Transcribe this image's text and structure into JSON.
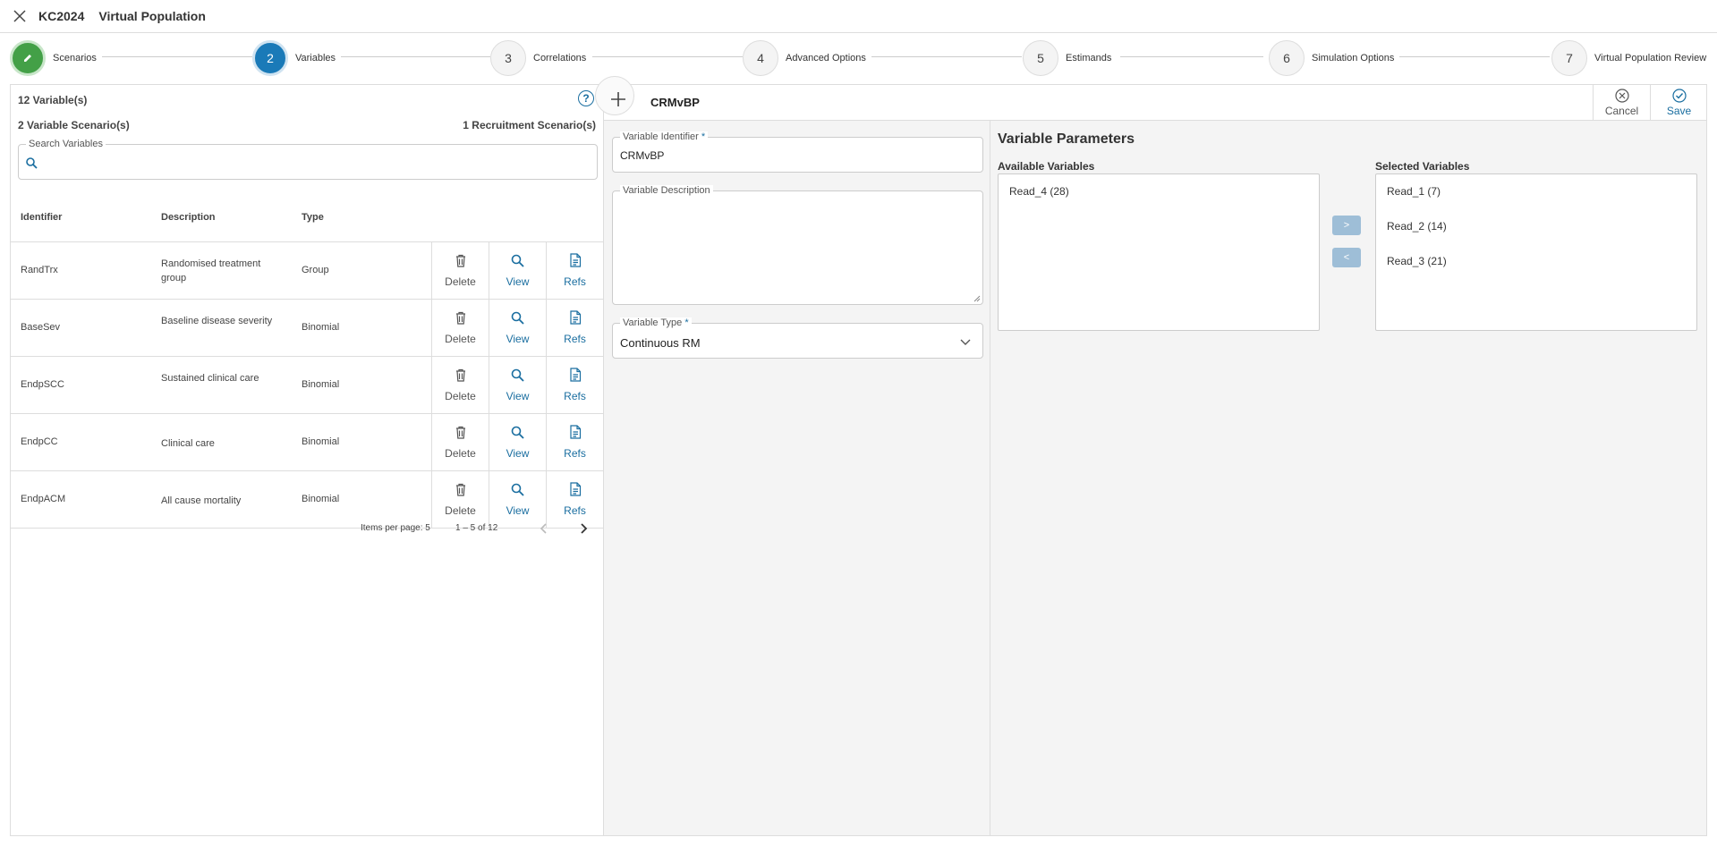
{
  "header": {
    "code": "KC2024",
    "title": "Virtual Population"
  },
  "stepper": [
    {
      "num": "",
      "label": "Scenarios",
      "state": "done"
    },
    {
      "num": "2",
      "label": "Variables",
      "state": "active"
    },
    {
      "num": "3",
      "label": "Correlations",
      "state": "pending"
    },
    {
      "num": "4",
      "label": "Advanced Options",
      "state": "pending"
    },
    {
      "num": "5",
      "label": "Estimands",
      "state": "pending"
    },
    {
      "num": "6",
      "label": "Simulation Options",
      "state": "pending"
    },
    {
      "num": "7",
      "label": "Virtual Population Review",
      "state": "pending"
    }
  ],
  "left": {
    "count": "12 Variable(s)",
    "variable_scenarios": "2 Variable Scenario(s)",
    "recruitment_scenarios": "1 Recruitment Scenario(s)",
    "search_label": "Search Variables",
    "search_value": "",
    "columns": [
      "Identifier",
      "Description",
      "Type"
    ],
    "rows": [
      {
        "id": "RandTrx",
        "desc": "Randomised treatment group",
        "type": "Group"
      },
      {
        "id": "BaseSev",
        "desc": "Baseline disease severity",
        "type": "Binomial"
      },
      {
        "id": "EndpSCC",
        "desc": "Sustained clinical care",
        "type": "Binomial"
      },
      {
        "id": "EndpCC",
        "desc": "Clinical care",
        "type": "Binomial"
      },
      {
        "id": "EndpACM",
        "desc": "All cause mortality",
        "type": "Binomial"
      }
    ],
    "actions": {
      "delete": "Delete",
      "view": "View",
      "refs": "Refs"
    },
    "pager": {
      "items_per_page": "Items per page: 5",
      "range": "1 – 5 of 12"
    }
  },
  "main": {
    "title": "CRMvBP",
    "cancel": "Cancel",
    "save": "Save",
    "identifier_label": "Variable Identifier",
    "identifier_value": "CRMvBP",
    "required_mark": "*",
    "description_label": "Variable Description",
    "description_value": "",
    "type_label": "Variable Type",
    "type_value": "Continuous RM",
    "params_title": "Variable Parameters",
    "available_title": "Available Variables",
    "selected_title": "Selected Variables",
    "available": [
      "Read_4 (28)"
    ],
    "selected": [
      "Read_1 (7)",
      "Read_2 (14)",
      "Read_3 (21)"
    ],
    "move_right": ">",
    "move_left": "<"
  },
  "colors": {
    "accent": "#1a7ab8",
    "done": "#43a047",
    "link": "#1a6ea0"
  }
}
